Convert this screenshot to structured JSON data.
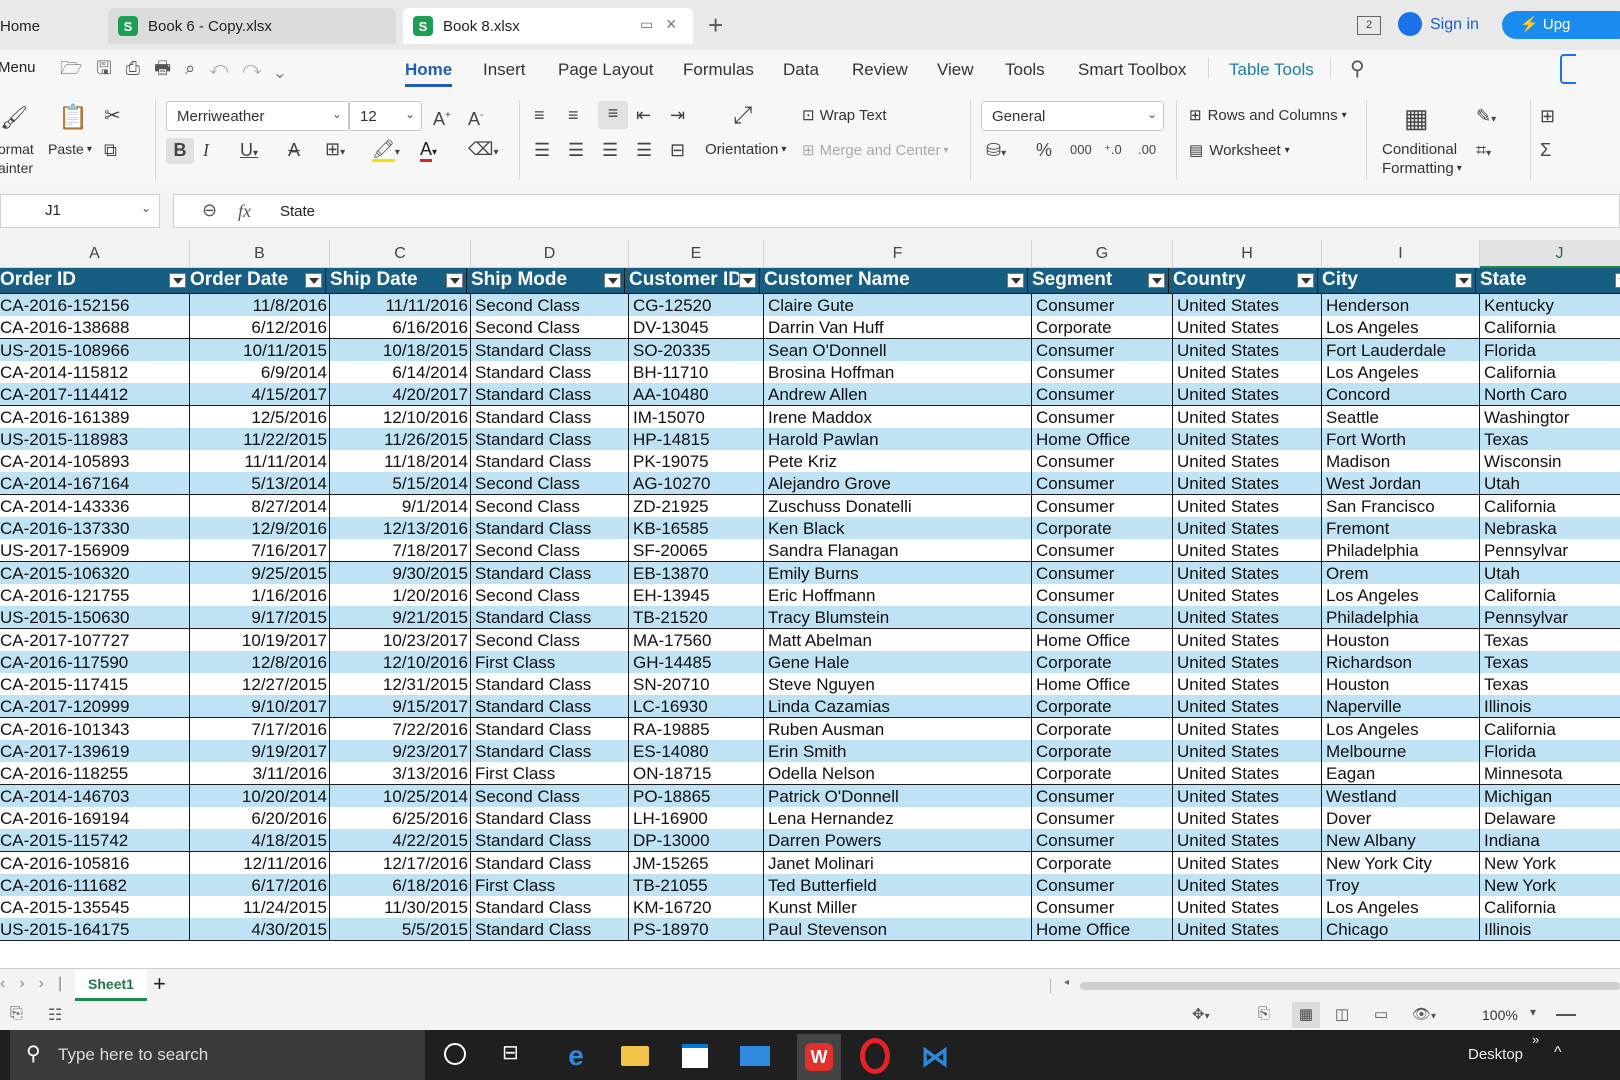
{
  "tabs": [
    {
      "label": "Home"
    },
    {
      "label": "Book 6 - Copy.xlsx"
    },
    {
      "label": "Book 8.xlsx"
    }
  ],
  "titlebar": {
    "sign_in": "Sign in",
    "upgrade": "Upg",
    "window_count": "2"
  },
  "menu": {
    "menu_label": "Menu",
    "items": [
      "Home",
      "Insert",
      "Page Layout",
      "Formulas",
      "Data",
      "Review",
      "View",
      "Tools",
      "Smart Toolbox",
      "Table Tools"
    ]
  },
  "ribbon": {
    "format_painter_1": "ormat",
    "format_painter_2": "ainter",
    "paste": "Paste",
    "font_name": "Merriweather",
    "font_size": "12",
    "wrap_text": "Wrap Text",
    "orientation": "Orientation",
    "merge_center": "Merge and Center",
    "number_format": "General",
    "rows_columns": "Rows and Columns",
    "worksheet": "Worksheet",
    "conditional_1": "Conditional",
    "conditional_2": "Formatting"
  },
  "formula_bar": {
    "cell_ref": "J1",
    "fx": "fx",
    "content": "State"
  },
  "columns": [
    "A",
    "B",
    "C",
    "D",
    "E",
    "F",
    "G",
    "H",
    "I",
    "J"
  ],
  "headers": [
    "Order ID",
    "Order Date",
    "Ship Date",
    "Ship Mode",
    "Customer ID",
    "Customer Name",
    "Segment",
    "Country",
    "City",
    "State"
  ],
  "rows": [
    [
      "CA-2016-152156",
      "11/8/2016",
      "11/11/2016",
      "Second Class",
      "CG-12520",
      "Claire Gute",
      "Consumer",
      "United States",
      "Henderson",
      "Kentucky"
    ],
    [
      "CA-2016-138688",
      "6/12/2016",
      "6/16/2016",
      "Second Class",
      "DV-13045",
      "Darrin Van Huff",
      "Corporate",
      "United States",
      "Los Angeles",
      "California"
    ],
    [
      "US-2015-108966",
      "10/11/2015",
      "10/18/2015",
      "Standard Class",
      "SO-20335",
      "Sean O'Donnell",
      "Consumer",
      "United States",
      "Fort Lauderdale",
      "Florida"
    ],
    [
      "CA-2014-115812",
      "6/9/2014",
      "6/14/2014",
      "Standard Class",
      "BH-11710",
      "Brosina Hoffman",
      "Consumer",
      "United States",
      "Los Angeles",
      "California"
    ],
    [
      "CA-2017-114412",
      "4/15/2017",
      "4/20/2017",
      "Standard Class",
      "AA-10480",
      "Andrew Allen",
      "Consumer",
      "United States",
      "Concord",
      "North Caro"
    ],
    [
      "CA-2016-161389",
      "12/5/2016",
      "12/10/2016",
      "Standard Class",
      "IM-15070",
      "Irene Maddox",
      "Consumer",
      "United States",
      "Seattle",
      "Washingtor"
    ],
    [
      "US-2015-118983",
      "11/22/2015",
      "11/26/2015",
      "Standard Class",
      "HP-14815",
      "Harold Pawlan",
      "Home Office",
      "United States",
      "Fort Worth",
      "Texas"
    ],
    [
      "CA-2014-105893",
      "11/11/2014",
      "11/18/2014",
      "Standard Class",
      "PK-19075",
      "Pete Kriz",
      "Consumer",
      "United States",
      "Madison",
      "Wisconsin"
    ],
    [
      "CA-2014-167164",
      "5/13/2014",
      "5/15/2014",
      "Second Class",
      "AG-10270",
      "Alejandro Grove",
      "Consumer",
      "United States",
      "West Jordan",
      "Utah"
    ],
    [
      "CA-2014-143336",
      "8/27/2014",
      "9/1/2014",
      "Second Class",
      "ZD-21925",
      "Zuschuss Donatelli",
      "Consumer",
      "United States",
      "San Francisco",
      "California"
    ],
    [
      "CA-2016-137330",
      "12/9/2016",
      "12/13/2016",
      "Standard Class",
      "KB-16585",
      "Ken Black",
      "Corporate",
      "United States",
      "Fremont",
      "Nebraska"
    ],
    [
      "US-2017-156909",
      "7/16/2017",
      "7/18/2017",
      "Second Class",
      "SF-20065",
      "Sandra Flanagan",
      "Consumer",
      "United States",
      "Philadelphia",
      "Pennsylvar"
    ],
    [
      "CA-2015-106320",
      "9/25/2015",
      "9/30/2015",
      "Standard Class",
      "EB-13870",
      "Emily Burns",
      "Consumer",
      "United States",
      "Orem",
      "Utah"
    ],
    [
      "CA-2016-121755",
      "1/16/2016",
      "1/20/2016",
      "Second Class",
      "EH-13945",
      "Eric Hoffmann",
      "Consumer",
      "United States",
      "Los Angeles",
      "California"
    ],
    [
      "US-2015-150630",
      "9/17/2015",
      "9/21/2015",
      "Standard Class",
      "TB-21520",
      "Tracy Blumstein",
      "Consumer",
      "United States",
      "Philadelphia",
      "Pennsylvar"
    ],
    [
      "CA-2017-107727",
      "10/19/2017",
      "10/23/2017",
      "Second Class",
      "MA-17560",
      "Matt Abelman",
      "Home Office",
      "United States",
      "Houston",
      "Texas"
    ],
    [
      "CA-2016-117590",
      "12/8/2016",
      "12/10/2016",
      "First Class",
      "GH-14485",
      "Gene Hale",
      "Corporate",
      "United States",
      "Richardson",
      "Texas"
    ],
    [
      "CA-2015-117415",
      "12/27/2015",
      "12/31/2015",
      "Standard Class",
      "SN-20710",
      "Steve Nguyen",
      "Home Office",
      "United States",
      "Houston",
      "Texas"
    ],
    [
      "CA-2017-120999",
      "9/10/2017",
      "9/15/2017",
      "Standard Class",
      "LC-16930",
      "Linda Cazamias",
      "Corporate",
      "United States",
      "Naperville",
      "Illinois"
    ],
    [
      "CA-2016-101343",
      "7/17/2016",
      "7/22/2016",
      "Standard Class",
      "RA-19885",
      "Ruben Ausman",
      "Corporate",
      "United States",
      "Los Angeles",
      "California"
    ],
    [
      "CA-2017-139619",
      "9/19/2017",
      "9/23/2017",
      "Standard Class",
      "ES-14080",
      "Erin Smith",
      "Corporate",
      "United States",
      "Melbourne",
      "Florida"
    ],
    [
      "CA-2016-118255",
      "3/11/2016",
      "3/13/2016",
      "First Class",
      "ON-18715",
      "Odella Nelson",
      "Corporate",
      "United States",
      "Eagan",
      "Minnesota"
    ],
    [
      "CA-2014-146703",
      "10/20/2014",
      "10/25/2014",
      "Second Class",
      "PO-18865",
      "Patrick O'Donnell",
      "Consumer",
      "United States",
      "Westland",
      "Michigan"
    ],
    [
      "CA-2016-169194",
      "6/20/2016",
      "6/25/2016",
      "Standard Class",
      "LH-16900",
      "Lena Hernandez",
      "Consumer",
      "United States",
      "Dover",
      "Delaware"
    ],
    [
      "CA-2015-115742",
      "4/18/2015",
      "4/22/2015",
      "Standard Class",
      "DP-13000",
      "Darren Powers",
      "Consumer",
      "United States",
      "New Albany",
      "Indiana"
    ],
    [
      "CA-2016-105816",
      "12/11/2016",
      "12/17/2016",
      "Standard Class",
      "JM-15265",
      "Janet Molinari",
      "Corporate",
      "United States",
      "New York City",
      "New York"
    ],
    [
      "CA-2016-111682",
      "6/17/2016",
      "6/18/2016",
      "First Class",
      "TB-21055",
      "Ted Butterfield",
      "Consumer",
      "United States",
      "Troy",
      "New York"
    ],
    [
      "CA-2015-135545",
      "11/24/2015",
      "11/30/2015",
      "Standard Class",
      "KM-16720",
      "Kunst Miller",
      "Consumer",
      "United States",
      "Los Angeles",
      "California"
    ],
    [
      "US-2015-164175",
      "4/30/2015",
      "5/5/2015",
      "Standard Class",
      "PS-18970",
      "Paul Stevenson",
      "Home Office",
      "United States",
      "Chicago",
      "Illinois"
    ]
  ],
  "sheet": {
    "name": "Sheet1",
    "add": "+"
  },
  "status": {
    "zoom": "100%"
  },
  "taskbar": {
    "search_placeholder": "Type here to search",
    "desktop": "Desktop"
  },
  "colors": {
    "header_bg": "#175e82",
    "band_bg": "#bfe2f4",
    "accent": "#1a73e8"
  }
}
